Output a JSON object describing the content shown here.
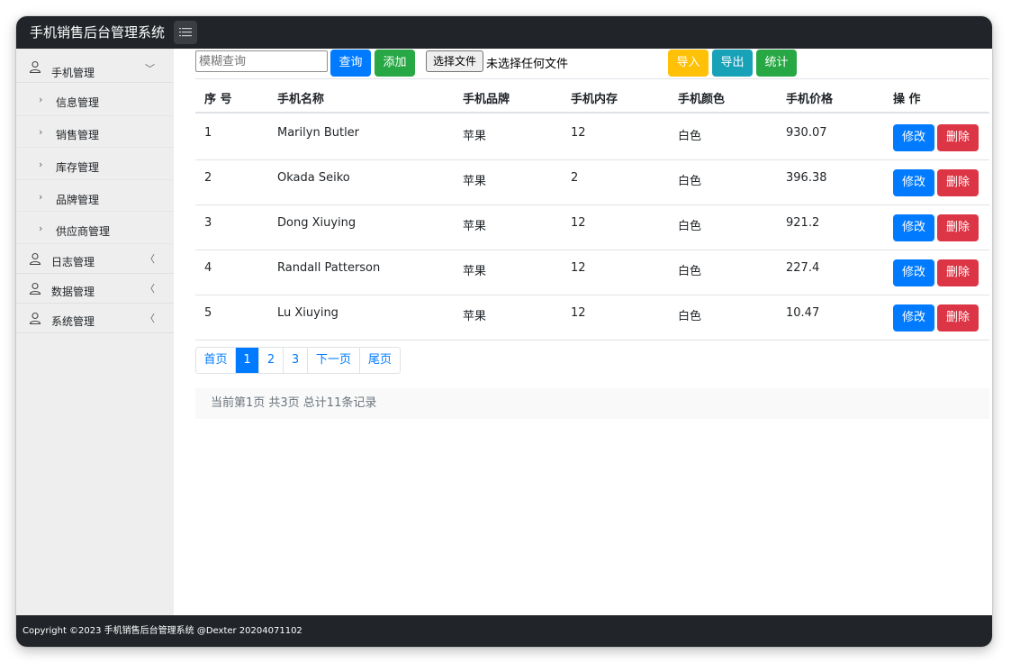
{
  "app": {
    "title": "手机销售后台管理系统"
  },
  "sidebar": {
    "sections": [
      {
        "label": "手机管理",
        "chevron": "﹀"
      },
      {
        "label": "日志管理",
        "chevron": "〈"
      },
      {
        "label": "数据管理",
        "chevron": "〈"
      },
      {
        "label": "系统管理",
        "chevron": "〈"
      }
    ],
    "subitems": [
      {
        "label": "信息管理"
      },
      {
        "label": "销售管理"
      },
      {
        "label": "库存管理"
      },
      {
        "label": "品牌管理"
      },
      {
        "label": "供应商管理"
      }
    ]
  },
  "toolbar": {
    "search_placeholder": "模糊查询",
    "query_label": "查询",
    "add_label": "添加",
    "file_button_label": "选择文件",
    "file_status": "未选择任何文件",
    "import_label": "导入",
    "export_label": "导出",
    "stats_label": "统计"
  },
  "table": {
    "headers": [
      "序 号",
      "手机名称",
      "手机品牌",
      "手机内存",
      "手机颜色",
      "手机价格",
      "操 作"
    ],
    "rows": [
      [
        "1",
        "Marilyn Butler",
        "苹果",
        "12",
        "白色",
        "930.07"
      ],
      [
        "2",
        "Okada Seiko",
        "苹果",
        "2",
        "白色",
        "396.38"
      ],
      [
        "3",
        "Dong Xiuying",
        "苹果",
        "12",
        "白色",
        "921.2"
      ],
      [
        "4",
        "Randall Patterson",
        "苹果",
        "12",
        "白色",
        "227.4"
      ],
      [
        "5",
        "Lu Xiuying",
        "苹果",
        "12",
        "白色",
        "10.47"
      ]
    ],
    "edit_label": "修改",
    "delete_label": "删除"
  },
  "pagination": {
    "first": "首页",
    "pages": [
      "1",
      "2",
      "3"
    ],
    "current": "1",
    "next": "下一页",
    "last": "尾页",
    "info": "当前第1页 共3页 总计11条记录"
  },
  "footer": {
    "text": "Copyright ©2023 手机销售后台管理系统 @Dexter 20204071102"
  },
  "colors": {
    "primary": "#007bff",
    "success": "#28a745",
    "warning": "#ffc107",
    "info": "#17a2b8",
    "danger": "#dc3545",
    "dark": "#212529"
  }
}
